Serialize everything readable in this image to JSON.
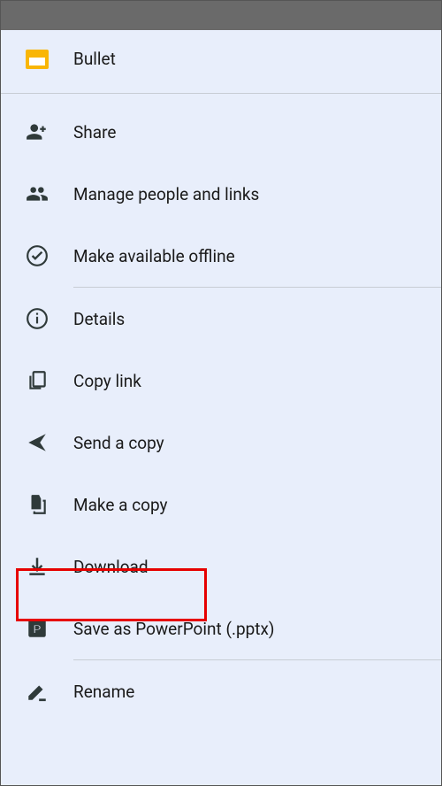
{
  "header": {
    "title": "Bullet"
  },
  "menu": {
    "items": [
      {
        "label": "Share",
        "icon": "person-add"
      },
      {
        "label": "Manage people and links",
        "icon": "people"
      },
      {
        "label": "Make available offline",
        "icon": "offline"
      },
      {
        "label": "Details",
        "icon": "info"
      },
      {
        "label": "Copy link",
        "icon": "copy"
      },
      {
        "label": "Send a copy",
        "icon": "send"
      },
      {
        "label": "Make a copy",
        "icon": "file-copy"
      },
      {
        "label": "Download",
        "icon": "download"
      },
      {
        "label": "Save as PowerPoint (.pptx)",
        "icon": "powerpoint"
      },
      {
        "label": "Rename",
        "icon": "rename"
      }
    ]
  }
}
